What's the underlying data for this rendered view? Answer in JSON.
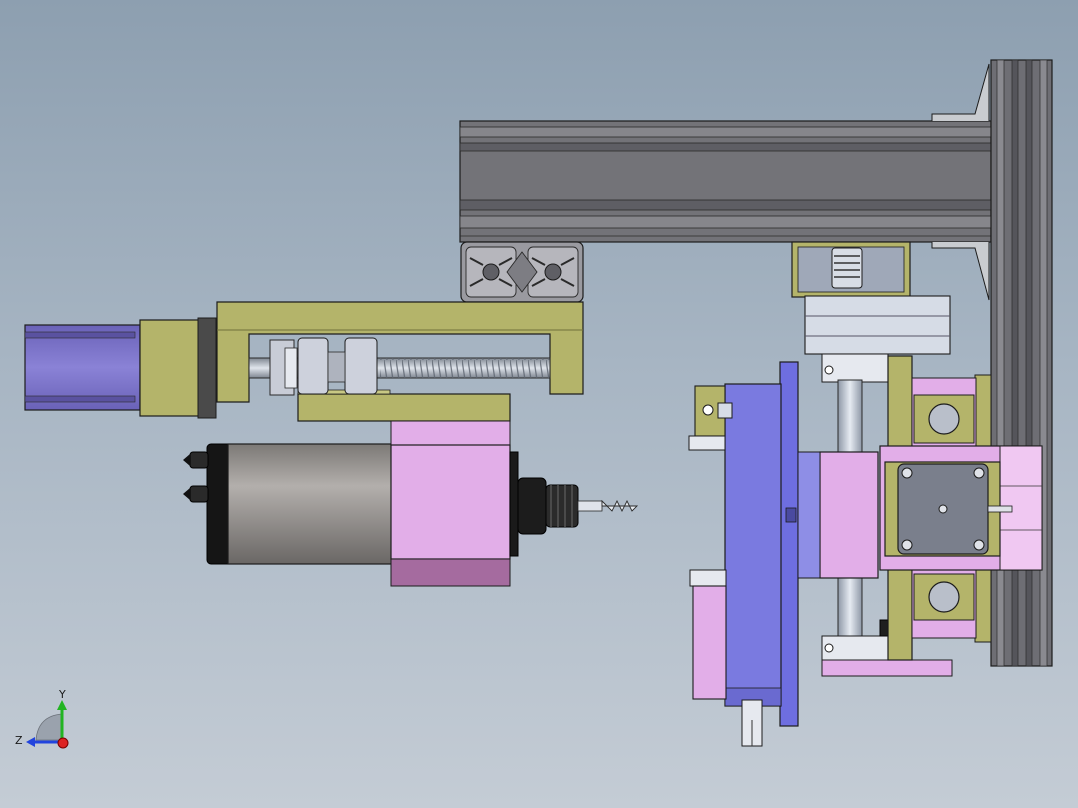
{
  "view": {
    "type": "CAD model viewport",
    "background": [
      "#8d9fb0",
      "#c4ccd5"
    ]
  },
  "colors": {
    "extrusion": "#737378",
    "extrusion_dark": "#5a5a60",
    "bracket_olive": "#b4b46a",
    "stepper_motor": "#7c72c8",
    "spindle_body": "#9e9a98",
    "spindle_head": "#e2aee8",
    "plate_blue": "#7a7ae0",
    "bearing_silver": "#d6dce6",
    "outline": "#1c1c1c"
  },
  "components": [
    {
      "name": "aluminium-profile-horizontal",
      "icon": "extrusion-profile"
    },
    {
      "name": "aluminium-profile-vertical",
      "icon": "extrusion-profile"
    },
    {
      "name": "profile-end-section",
      "icon": "t-slot-section"
    },
    {
      "name": "z-axis-stepper-motor",
      "icon": "nema-motor"
    },
    {
      "name": "ball-screw",
      "icon": "lead-screw"
    },
    {
      "name": "spindle-motor",
      "icon": "spindle"
    },
    {
      "name": "drill-bit",
      "icon": "drill"
    },
    {
      "name": "shaft-coupling",
      "icon": "coupling"
    },
    {
      "name": "linear-guide-rail",
      "icon": "rail"
    },
    {
      "name": "carriage-plate",
      "icon": "plate"
    },
    {
      "name": "y-axis-stepper-motor",
      "icon": "nema-motor"
    }
  ],
  "triad": {
    "y_label": "Y",
    "z_label": "Z",
    "colors": {
      "y": "#22b422",
      "z": "#2244dd",
      "x": "#dd2222"
    }
  }
}
